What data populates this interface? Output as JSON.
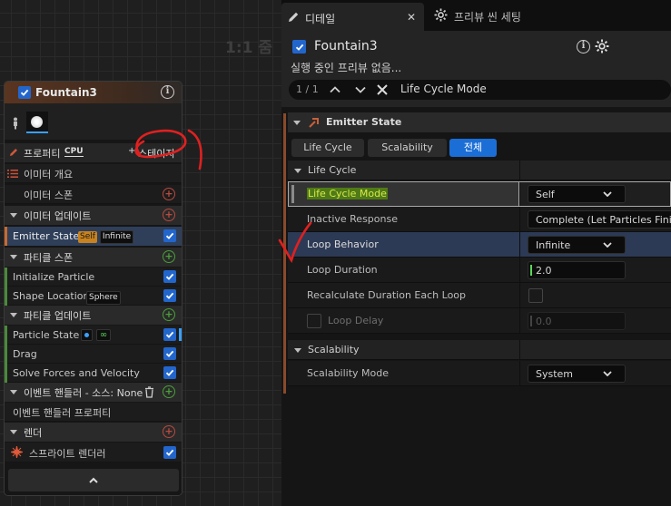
{
  "graph": {
    "zoom_label": "1:1 줌"
  },
  "node": {
    "title": "Fountain3",
    "properties_label": "프로퍼티",
    "cpu_badge": "CPU",
    "stage_button": "스테이지",
    "sections": [
      {
        "label": "이미터 개요",
        "type": "item-section"
      },
      {
        "label": "이미터 스폰",
        "type": "item"
      },
      {
        "label": "이미터 업데이트",
        "type": "section"
      },
      {
        "label": "Emitter State",
        "badges": [
          "Self",
          "Infinite"
        ],
        "type": "item",
        "selected": true
      },
      {
        "label": "파티클 스폰",
        "type": "section"
      },
      {
        "label": "Initialize Particle",
        "type": "item"
      },
      {
        "label": "Shape Location",
        "badges": [
          "Sphere"
        ],
        "type": "item"
      },
      {
        "label": "파티클 업데이트",
        "type": "section"
      },
      {
        "label": "Particle State",
        "type": "item"
      },
      {
        "label": "Drag",
        "type": "item"
      },
      {
        "label": "Solve Forces and Velocity",
        "type": "item"
      },
      {
        "label": "이벤트 핸들러 - 소스: None",
        "type": "section"
      },
      {
        "label": "이벤트 핸들러 프로퍼티",
        "type": "item"
      },
      {
        "label": "렌더",
        "type": "section"
      },
      {
        "label": "스프라이트 렌더러",
        "type": "item"
      }
    ]
  },
  "panel": {
    "tabs": [
      {
        "label": "디테일"
      },
      {
        "label": "프리뷰 씬 세팅"
      }
    ],
    "object_title": "Fountain3",
    "preview_status": "실행 중인 프리뷰 없음...",
    "search": {
      "count": "1 / 1",
      "query": "Life Cycle Mode"
    },
    "category": "Emitter State",
    "filter_buttons": [
      {
        "label": "Life Cycle"
      },
      {
        "label": "Scalability"
      },
      {
        "label": "전체"
      }
    ],
    "groups": {
      "life_cycle": "Life Cycle",
      "scalability": "Scalability"
    },
    "properties": {
      "life_cycle_mode": {
        "name": "Life Cycle Mode",
        "value": "Self"
      },
      "inactive_response": {
        "name": "Inactive Response",
        "value": "Complete (Let Particles Finish)"
      },
      "loop_behavior": {
        "name": "Loop Behavior",
        "value": "Infinite"
      },
      "loop_duration": {
        "name": "Loop Duration",
        "value": "2.0"
      },
      "recalc": {
        "name": "Recalculate Duration Each Loop"
      },
      "loop_delay": {
        "name": "Loop Delay",
        "value": "0.0"
      },
      "scalability_mode": {
        "name": "Scalability Mode",
        "value": "System"
      }
    }
  },
  "colors": {
    "accent_blue": "#1b6ed6",
    "emitter_orange": "#8a4a2a",
    "annotation_red": "#e02020"
  }
}
